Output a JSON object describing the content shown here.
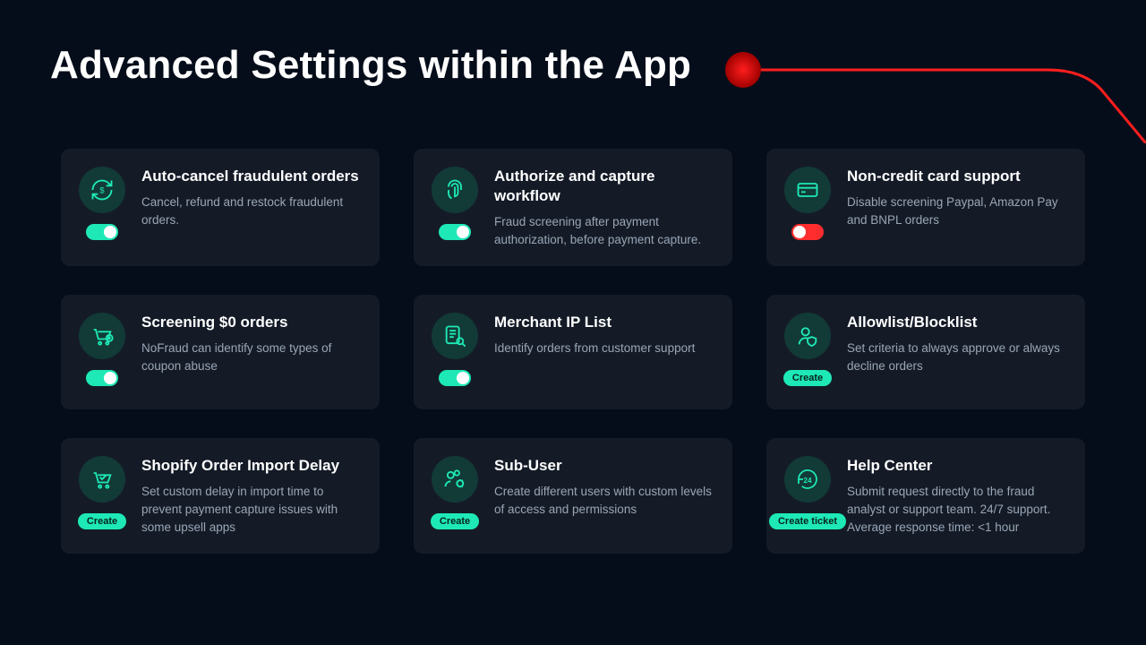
{
  "page_title": "Advanced Settings within the App",
  "cards": [
    {
      "title": "Auto-cancel fraudulent orders",
      "desc": "Cancel, refund and restock fraudulent orders.",
      "control": "toggle-on"
    },
    {
      "title": "Authorize and capture workflow",
      "desc": "Fraud screening after payment authorization, before payment capture.",
      "control": "toggle-on"
    },
    {
      "title": "Non-credit card support",
      "desc": "Disable screening Paypal, Amazon Pay and BNPL orders",
      "control": "toggle-off"
    },
    {
      "title": "Screening $0 orders",
      "desc": "NoFraud can identify some types of coupon abuse",
      "control": "toggle-on"
    },
    {
      "title": "Merchant IP List",
      "desc": "Identify orders from customer support",
      "control": "toggle-on"
    },
    {
      "title": "Allowlist/Blocklist",
      "desc": "Set criteria to always approve or always decline orders",
      "control": "create",
      "button_label": "Create"
    },
    {
      "title": "Shopify Order Import Delay",
      "desc": "Set custom delay in import time to prevent payment capture issues with some upsell apps",
      "control": "create",
      "button_label": "Create"
    },
    {
      "title": "Sub-User",
      "desc": "Create different users with custom levels of access and permissions",
      "control": "create",
      "button_label": "Create"
    },
    {
      "title": "Help Center",
      "desc": "Submit request directly to the fraud analyst or support team. 24/7 support. Average response time: <1 hour",
      "control": "create",
      "button_label": "Create ticket"
    }
  ]
}
